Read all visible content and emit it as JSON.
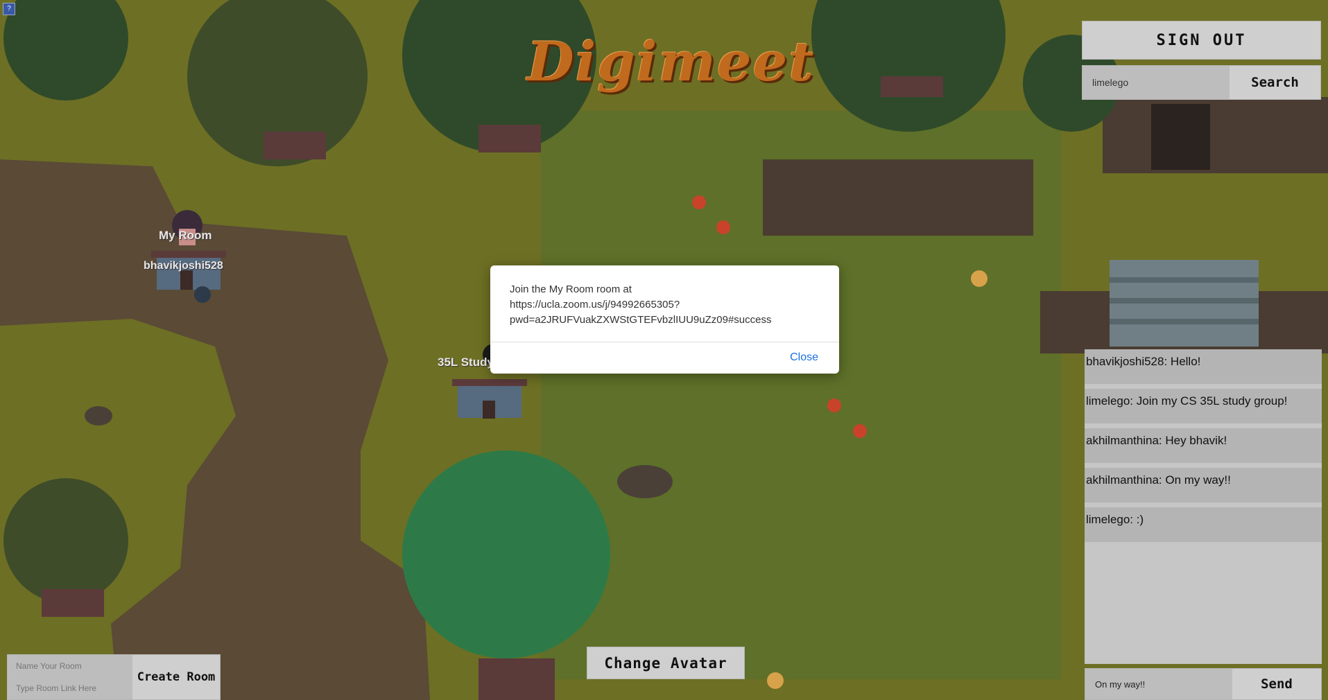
{
  "app": {
    "title": "Digimeet"
  },
  "header": {
    "sign_out_label": "SIGN OUT"
  },
  "search": {
    "value": "limelego",
    "button_label": "Search"
  },
  "map": {
    "labels": {
      "my_room": "My Room",
      "user_tag": "bhavikjoshi528",
      "study_room": "35L Study Group"
    }
  },
  "modal": {
    "message": "Join the My Room  room at\nhttps://ucla.zoom.us/j/94992665305?\npwd=a2JRUFVuakZXWStGTEFvbzlIUU9uZz09#success",
    "close_label": "Close"
  },
  "chat": {
    "messages": [
      "bhavikjoshi528: Hello!",
      "limelego: Join my CS 35L study group!",
      "akhilmanthina: Hey bhavik!",
      "akhilmanthina: On my way!!",
      "limelego: :)"
    ],
    "input_value": "On my way!!",
    "send_label": "Send"
  },
  "footer": {
    "change_avatar_label": "Change Avatar",
    "room_name_placeholder": "Name Your Room",
    "room_link_placeholder": "Type Room Link Here",
    "create_room_label": "Create Room"
  },
  "colors": {
    "grass": "#6d6f24",
    "path": "#5a4a36",
    "tree_dark": "#2f4a2a",
    "tree_green": "#2d7a48",
    "panel_gray": "#cfcfcf",
    "link_blue": "#1a6fe3"
  },
  "icons": {
    "corner": "help-icon"
  }
}
